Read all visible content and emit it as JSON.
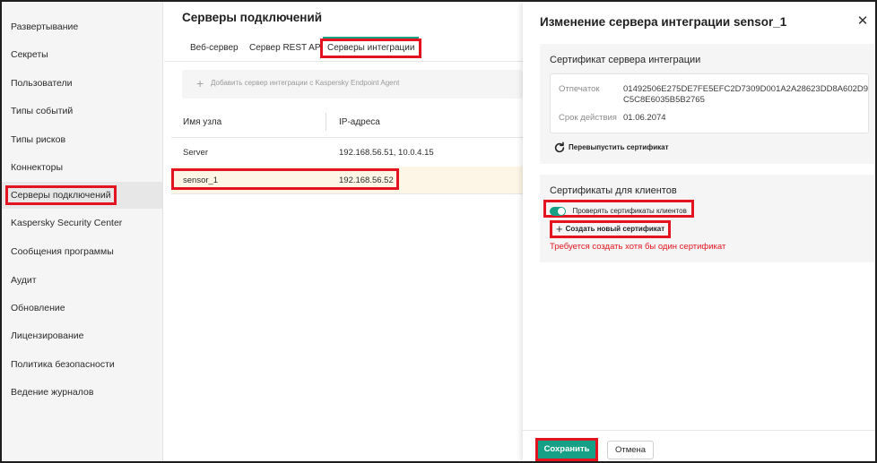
{
  "sidebar": {
    "items": [
      {
        "label": "Развертывание"
      },
      {
        "label": "Секреты"
      },
      {
        "label": "Пользователи"
      },
      {
        "label": "Типы событий"
      },
      {
        "label": "Типы рисков"
      },
      {
        "label": "Коннекторы"
      },
      {
        "label": "Серверы подключений"
      },
      {
        "label": "Kaspersky Security Center"
      },
      {
        "label": "Сообщения программы"
      },
      {
        "label": "Аудит"
      },
      {
        "label": "Обновление"
      },
      {
        "label": "Лицензирование"
      },
      {
        "label": "Политика безопасности"
      },
      {
        "label": "Ведение журналов"
      }
    ],
    "active_index": 6
  },
  "main": {
    "title": "Серверы подключений",
    "tabs": [
      {
        "label": "Веб-сервер"
      },
      {
        "label": "Сервер REST API"
      },
      {
        "label": "Серверы интеграции"
      }
    ],
    "active_tab": 2,
    "add_button_label": "Добавить сервер интеграции с Kaspersky Endpoint Agent",
    "table": {
      "columns": [
        "Имя узла",
        "IP-адреса"
      ],
      "rows": [
        {
          "name": "Server",
          "ips": "192.168.56.51, 10.0.4.15"
        },
        {
          "name": "sensor_1",
          "ips": "192.168.56.52"
        }
      ],
      "selected_row": 1
    }
  },
  "panel": {
    "title": "Изменение сервера интеграции sensor_1",
    "close_icon": "close-icon",
    "server_cert": {
      "title": "Сертификат сервера интеграции",
      "fingerprint_label": "Отпечаток",
      "fingerprint_line1": "01492506E275DE7FE5EFC2D7309D001A2A28623DD8A602D9",
      "fingerprint_line2": "C5C8E6035B5B2765",
      "expiry_label": "Срок действия",
      "expiry_value": "01.06.2074",
      "reissue_label": "Перевыпустить сертификат"
    },
    "client_certs": {
      "title": "Сертификаты для клиентов",
      "toggle_label": "Проверять сертификаты клиентов",
      "toggle_on": true,
      "create_label": "Создать новый сертификат",
      "warning": "Требуется создать хотя бы один сертификат"
    },
    "footer": {
      "save_label": "Сохранить",
      "cancel_label": "Отмена"
    }
  },
  "colors": {
    "accent": "#16a085",
    "highlight": "#e3141f",
    "selected_row": "#fdf6e6"
  }
}
